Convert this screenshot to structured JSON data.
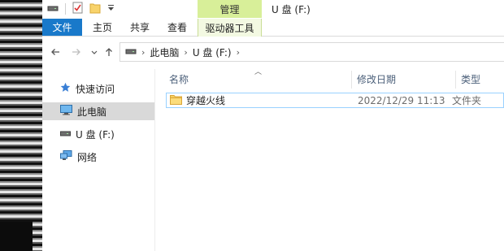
{
  "title_bar": {
    "context_tab_header": "管理",
    "window_title": "U 盘 (F:)"
  },
  "ribbon": {
    "tabs": [
      "文件",
      "主页",
      "共享",
      "查看",
      "驱动器工具"
    ]
  },
  "address": {
    "path": [
      "此电脑",
      "U 盘 (F:)"
    ]
  },
  "nav_pane": {
    "items": [
      {
        "label": "快速访问",
        "icon": "star-icon"
      },
      {
        "label": "此电脑",
        "icon": "computer-icon",
        "selected": true
      },
      {
        "label": "U 盘 (F:)",
        "icon": "usb-drive-icon"
      },
      {
        "label": "网络",
        "icon": "network-icon"
      }
    ]
  },
  "file_list": {
    "columns": [
      "名称",
      "修改日期",
      "类型"
    ],
    "rows": [
      {
        "name": "穿越火线",
        "modified": "2022/12/29 11:13",
        "type": "文件夹",
        "icon": "folder-icon"
      }
    ]
  },
  "colors": {
    "file_tab": "#1979ca",
    "context_tab": "#d8ef99",
    "selection_border": "#99d1ff",
    "selected_nav": "#d9d9d9"
  }
}
